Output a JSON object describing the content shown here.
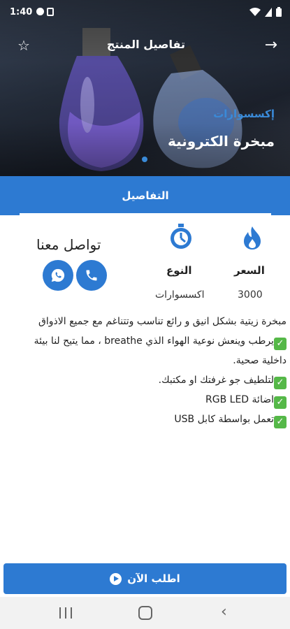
{
  "status": {
    "time": "1:40"
  },
  "header": {
    "title": "تفاصيل المنتج",
    "back_icon": "arrow-back-icon",
    "favorite_icon": "star-outline-icon"
  },
  "hero": {
    "category": "إكسسوارات",
    "product_name": "مبخرة الكترونية"
  },
  "tabs": [
    {
      "label": "التفاصيل",
      "active": true
    }
  ],
  "info": {
    "price_label": "السعر",
    "price_value": "3000",
    "type_label": "النوع",
    "type_value": "اكسسوارات",
    "contact_title": "تواصل معنا"
  },
  "description": {
    "intro": "مبخرة زيتية بشكل انيق و رائع تناسب وتتناغم مع جميع الاذواق",
    "features": [
      "يرطب وينعش نوعية الهواء الذي breathe ، مما يتيح لنا بيئة داخلية صحية.",
      "لتلطيف جو غرفتك او مكتبك.",
      "اضائة RGB LED",
      "تعمل بواسطة كابل USB"
    ]
  },
  "order_button": {
    "label": "اطلب الآن"
  },
  "colors": {
    "primary": "#2d7ad2",
    "check": "#55b848"
  }
}
